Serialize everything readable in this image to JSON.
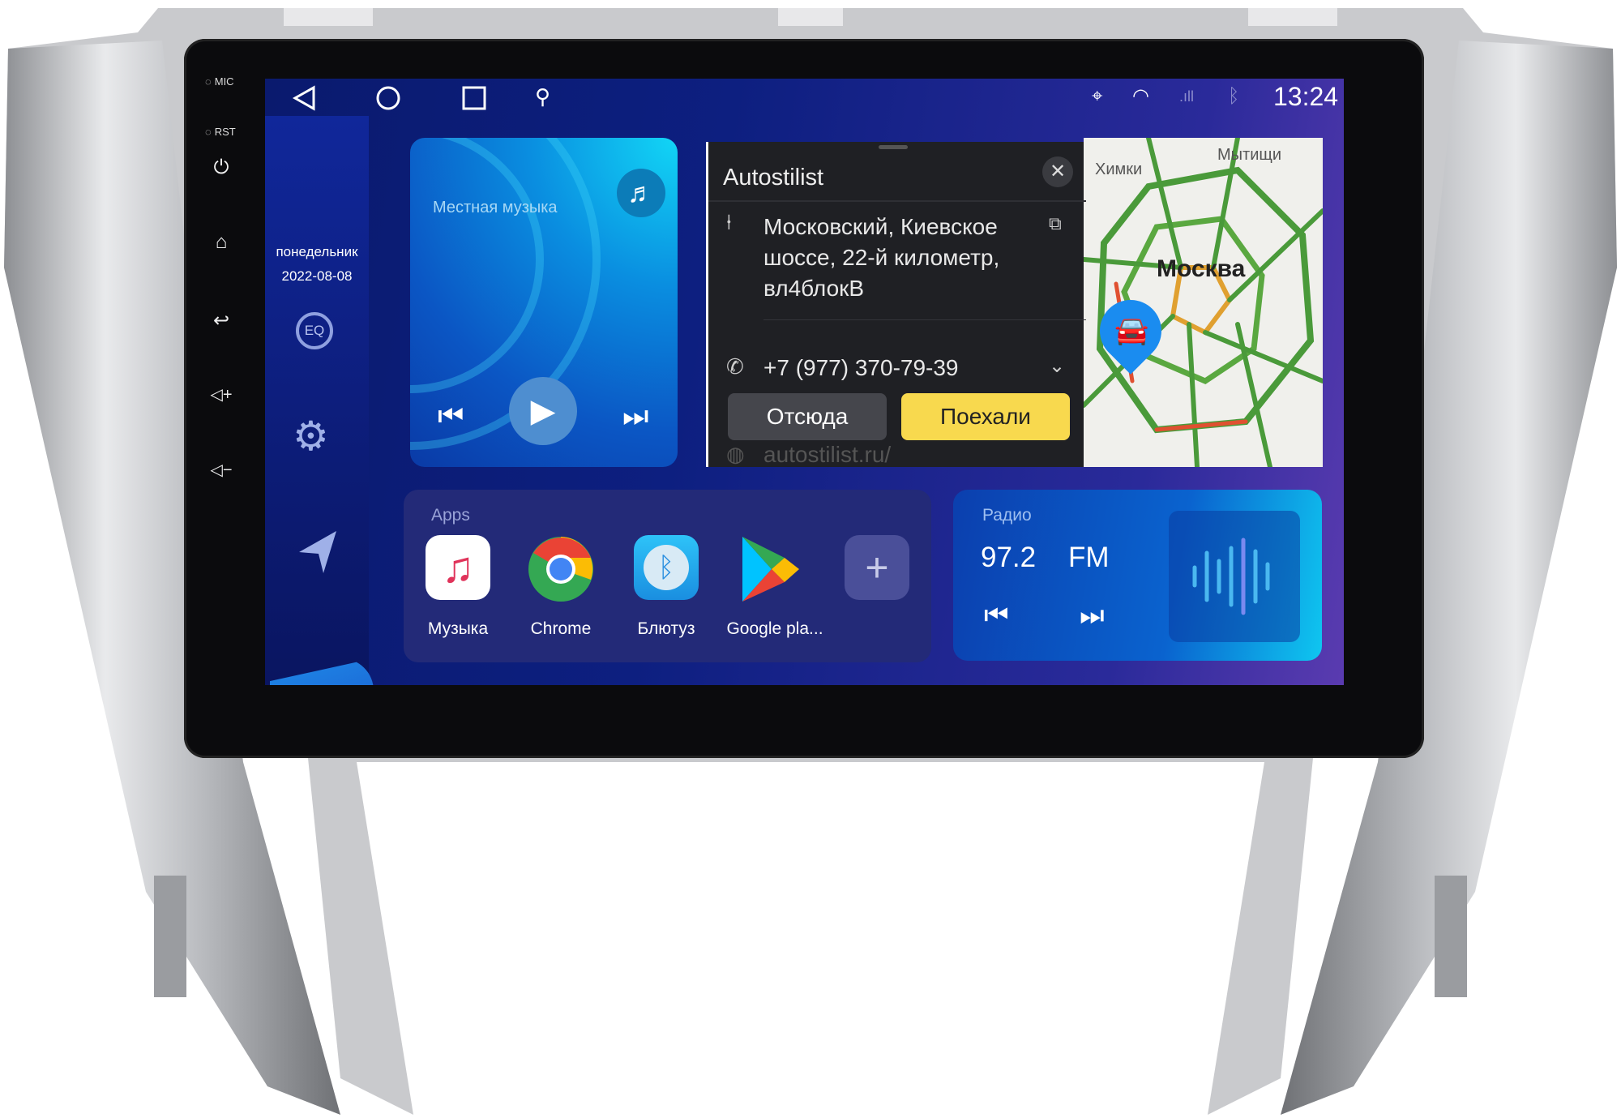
{
  "device": {
    "hw_labels": {
      "mic": "MIC",
      "rst": "RST"
    },
    "hw_buttons": [
      "power-icon",
      "home-icon",
      "back-icon",
      "volume-up-icon",
      "volume-down-icon"
    ]
  },
  "status_bar": {
    "nav_icons": [
      "back-triangle-icon",
      "home-circle-icon",
      "recents-square-icon",
      "usb-icon"
    ],
    "indicators": [
      "location-icon",
      "wifi-icon",
      "signal-icon",
      "bluetooth-icon"
    ],
    "time": "13:24"
  },
  "sidebar": {
    "weekday": "понедельник",
    "date": "2022-08-08",
    "icons": [
      "eq-icon",
      "gear-icon",
      "navigation-arrow-icon",
      "apps-grid-icon"
    ],
    "eq_label": "EQ"
  },
  "music_widget": {
    "title": "Местная музыка"
  },
  "navigation_card": {
    "title": "Autostilist",
    "address": "Московский, Киевское шоссе, 22-й километр, вл4блокВ",
    "phone": "+7 (977) 370-79-39",
    "from_button": "Отсюда",
    "go_button": "Поехали",
    "website": "autostilist.ru/",
    "colors": {
      "go": "#f8d94e",
      "from": "#45464c"
    }
  },
  "map": {
    "labels": {
      "khimki": "Химки",
      "mytishchi": "Мытищи",
      "moscow": "Москва"
    }
  },
  "apps": {
    "title": "Apps",
    "items": [
      {
        "label": "Музыка"
      },
      {
        "label": "Chrome"
      },
      {
        "label": "Блютуз"
      },
      {
        "label": "Google pla..."
      }
    ],
    "add_label": "+"
  },
  "radio": {
    "title": "Радио",
    "frequency": "97.2",
    "band": "FM"
  }
}
